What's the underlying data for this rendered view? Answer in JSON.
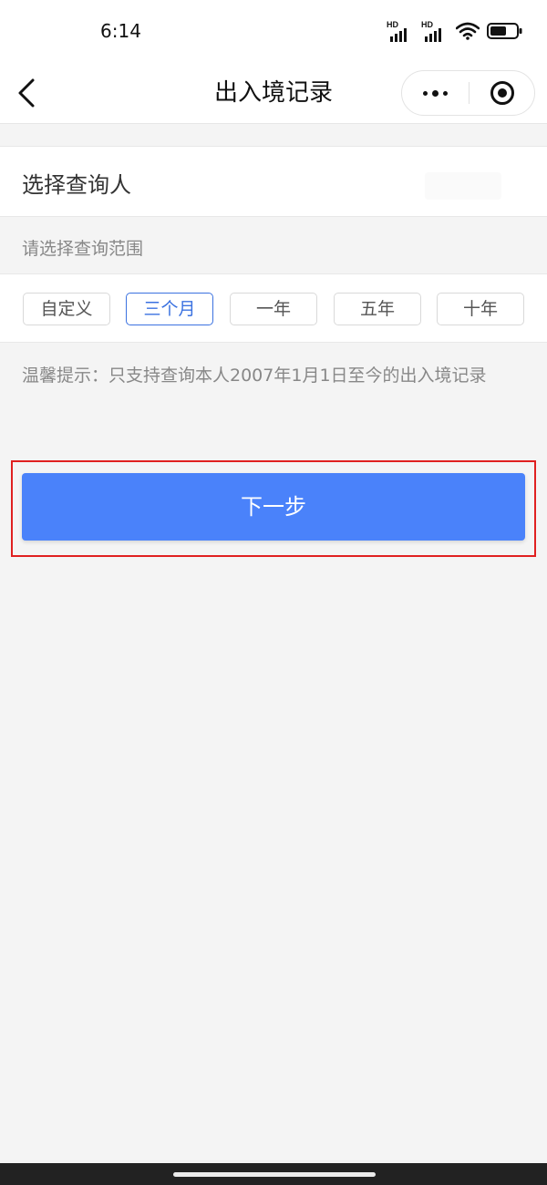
{
  "status_bar": {
    "time": "6:14",
    "signal_1_label": "HD",
    "signal_2_label": "HD",
    "battery_level": 0.6
  },
  "nav": {
    "title": "出入境记录",
    "back_icon": "chevron-left-icon",
    "more_icon": "more-dots-icon",
    "close_icon": "target-circle-icon"
  },
  "query_person": {
    "label": "选择查询人",
    "value": ""
  },
  "range": {
    "heading": "请选择查询范围",
    "options": [
      "自定义",
      "三个月",
      "一年",
      "五年",
      "十年"
    ],
    "selected": "三个月"
  },
  "tip": "温馨提示：只支持查询本人2007年1月1日至今的出入境记录",
  "next_button_label": "下一步",
  "colors": {
    "accent": "#4a82fa",
    "selected_border": "#3b72e0",
    "highlight": "#e02020"
  }
}
